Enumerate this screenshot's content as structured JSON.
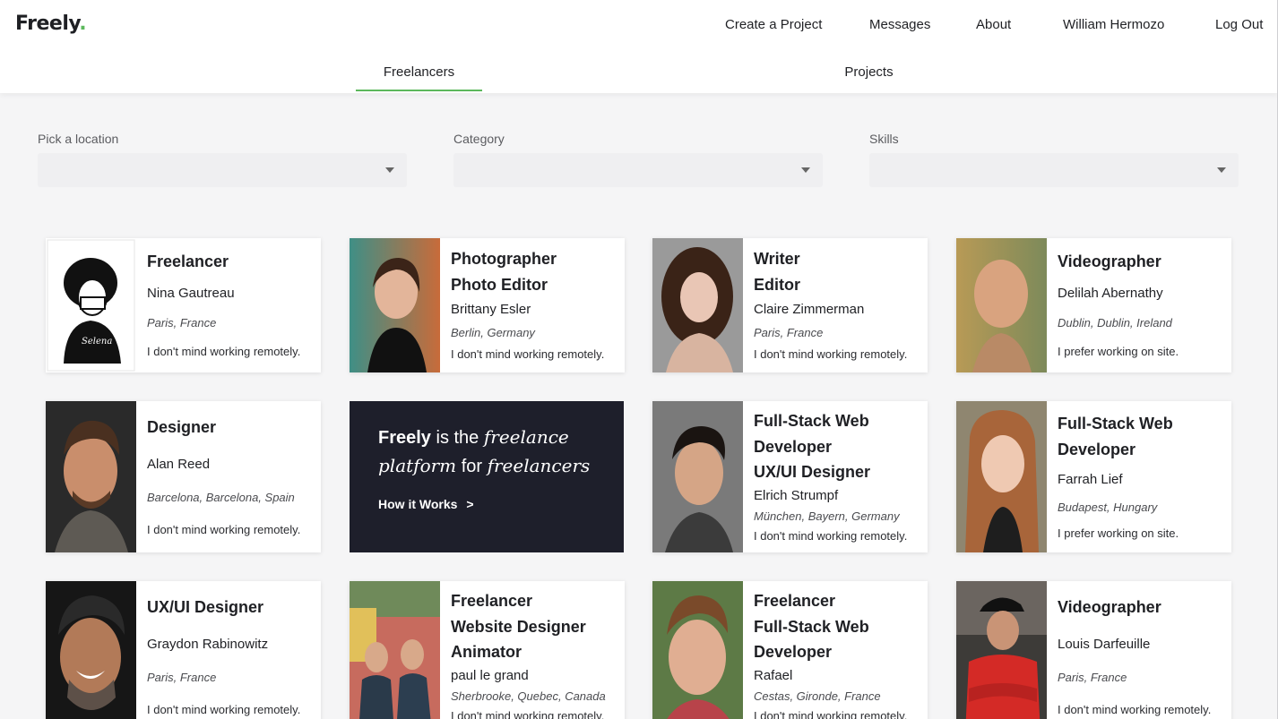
{
  "brand": {
    "name": "Freely",
    "dot": "."
  },
  "nav": {
    "create": "Create a Project",
    "messages": "Messages",
    "about": "About",
    "user": "William Hermozo",
    "logout": "Log Out"
  },
  "tabs": {
    "freelancers": "Freelancers",
    "projects": "Projects",
    "active": "Freelancers"
  },
  "filters": {
    "location": {
      "label": "Pick a location",
      "value": ""
    },
    "category": {
      "label": "Category",
      "value": ""
    },
    "skills": {
      "label": "Skills",
      "value": ""
    }
  },
  "promo": {
    "brand": "Freely",
    "is_the": " is the ",
    "freelance": "freelance",
    "platform": "platform",
    "for": " for ",
    "freelancers": "freelancers",
    "cta": "How it Works",
    "arrow": ">"
  },
  "cards": [
    {
      "roles": [
        "Freelancer"
      ],
      "name": "Nina Gautreau",
      "location": "Paris, France",
      "preference": "I don't mind working remotely."
    },
    {
      "roles": [
        "Photographer",
        "Photo Editor"
      ],
      "name": "Brittany Esler",
      "location": "Berlin, Germany",
      "preference": "I don't mind working remotely."
    },
    {
      "roles": [
        "Writer",
        "Editor"
      ],
      "name": "Claire Zimmerman",
      "location": "Paris, France",
      "preference": "I don't mind working remotely."
    },
    {
      "roles": [
        "Videographer"
      ],
      "name": "Delilah Abernathy",
      "location": "Dublin, Dublin, Ireland",
      "preference": "I prefer working on site."
    },
    {
      "roles": [
        "Designer"
      ],
      "name": "Alan Reed",
      "location": "Barcelona, Barcelona, Spain",
      "preference": "I don't mind working remotely."
    },
    {
      "roles": [
        "Full-Stack Web",
        "Developer",
        "UX/UI Designer"
      ],
      "name": "Elrich Strumpf",
      "location": "München, Bayern, Germany",
      "preference": "I don't mind working remotely."
    },
    {
      "roles": [
        "Full-Stack Web",
        "Developer"
      ],
      "name": "Farrah Lief",
      "location": "Budapest, Hungary",
      "preference": "I prefer working on site."
    },
    {
      "roles": [
        "UX/UI Designer"
      ],
      "name": "Graydon Rabinowitz",
      "location": "Paris, France",
      "preference": "I don't mind working remotely."
    },
    {
      "roles": [
        "Freelancer",
        "Website Designer",
        "Animator"
      ],
      "name": "paul le grand",
      "location": "Sherbrooke, Quebec, Canada",
      "preference": "I don't mind working remotely."
    },
    {
      "roles": [
        "Freelancer",
        "Full-Stack Web",
        "Developer"
      ],
      "name": "Rafael",
      "location": "Cestas, Gironde, France",
      "preference": "I don't mind working remotely."
    },
    {
      "roles": [
        "Videographer"
      ],
      "name": "Louis Darfeuille",
      "location": "Paris, France",
      "preference": "I don't mind working remotely."
    }
  ],
  "colors": {
    "accent": "#5cb85c",
    "promo_bg": "#1e1f2b",
    "page_bg": "#f5f5f6"
  }
}
